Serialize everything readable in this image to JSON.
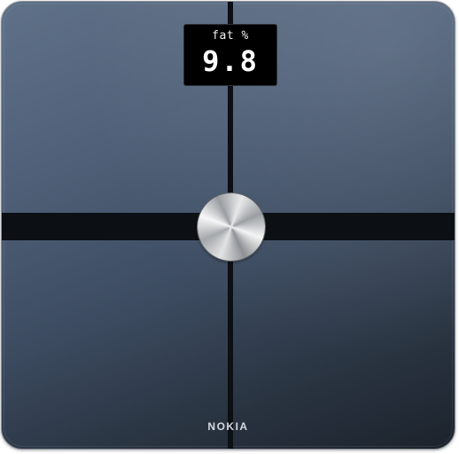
{
  "display": {
    "label": "fat %",
    "value": "9.8"
  },
  "brand": {
    "text": "NOKIA"
  },
  "colors": {
    "surface_top": "#5f7188",
    "surface_bottom": "#1c232c",
    "strip": "#0c0f13",
    "display_bg": "#000000",
    "display_text": "#ffffff"
  }
}
